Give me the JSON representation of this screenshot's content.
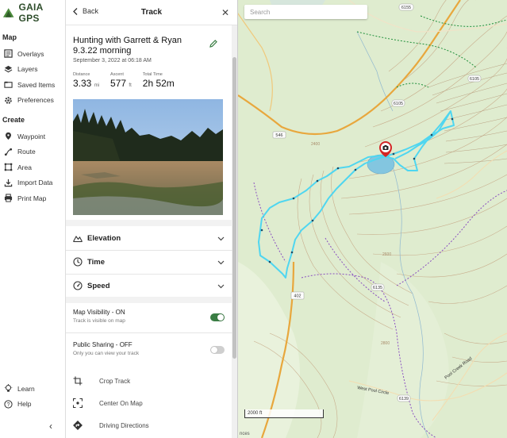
{
  "app": {
    "brand": "GAIA GPS"
  },
  "nav": {
    "map_section": "Map",
    "map_items": [
      {
        "label": "Overlays"
      },
      {
        "label": "Layers"
      },
      {
        "label": "Saved Items"
      },
      {
        "label": "Preferences"
      }
    ],
    "create_section": "Create",
    "create_items": [
      {
        "label": "Waypoint"
      },
      {
        "label": "Route"
      },
      {
        "label": "Area"
      },
      {
        "label": "Import Data"
      },
      {
        "label": "Print Map"
      }
    ],
    "bottom_items": [
      {
        "label": "Learn"
      },
      {
        "label": "Help"
      }
    ]
  },
  "panel": {
    "back_label": "Back",
    "title": "Track",
    "track": {
      "name": "Hunting with Garrett & Ryan 9.3.22 morning",
      "date": "September 3, 2022 at 06:18 AM",
      "stats": [
        {
          "label": "Distance",
          "value": "3.33",
          "unit": "mi"
        },
        {
          "label": "Ascent",
          "value": "577",
          "unit": "ft"
        },
        {
          "label": "Total Time",
          "value": "2h 52m",
          "unit": ""
        }
      ]
    },
    "accordions": [
      {
        "label": "Elevation"
      },
      {
        "label": "Time"
      },
      {
        "label": "Speed"
      }
    ],
    "visibility": {
      "title": "Map Visibility - ON",
      "subtitle": "Track is visible on map",
      "on": true
    },
    "sharing": {
      "title": "Public Sharing - OFF",
      "subtitle": "Only you can view your track",
      "on": false
    },
    "actions": [
      {
        "label": "Crop Track"
      },
      {
        "label": "Center On Map"
      },
      {
        "label": "Driving Directions"
      }
    ]
  },
  "map": {
    "search_placeholder": "Search",
    "scale_label": "2000 ft",
    "road_labels": [
      "6155",
      "6105",
      "546",
      "6105",
      "402",
      "6135",
      "6139",
      "West Pool Circle",
      "Pool Creek Road"
    ],
    "contour_labels": [
      "2400",
      "2600",
      "2800"
    ],
    "edge_text": "nces",
    "track_color": "#4fd6f0",
    "toggle_on_color": "#3a7d44"
  }
}
